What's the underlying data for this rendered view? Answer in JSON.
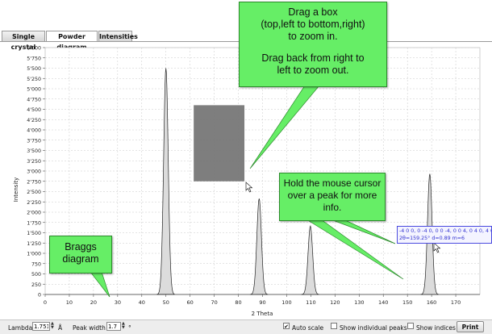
{
  "tabs": [
    {
      "label": "Single crystal",
      "active": false
    },
    {
      "label": "Powder diagram",
      "active": true
    },
    {
      "label": "Intensities",
      "active": false
    }
  ],
  "callouts": {
    "zoom_line1": "Drag a box",
    "zoom_line2": "(top,left to bottom,right)",
    "zoom_line3": "to zoom in.",
    "zoom_line4": "Drag back from right to",
    "zoom_line5": "left to zoom out.",
    "hover_line1": "Hold the mouse cursor",
    "hover_line2": "over a peak for more",
    "hover_line3": "info.",
    "braggs_line1": "Braggs",
    "braggs_line2": "diagram"
  },
  "tooltip": {
    "line1": "-4 0 0, 0 -4 0, 0 0 -4, 0 0 4, 0 4 0, 4 0 0",
    "line2": "2θ=159.25° d=0.89 m=6"
  },
  "chart_data": {
    "type": "line",
    "xlabel": "2 Theta",
    "ylabel": "Intensity",
    "xlim": [
      0,
      180
    ],
    "ylim": [
      0,
      6000
    ],
    "x_ticks": [
      0,
      10,
      20,
      30,
      40,
      50,
      60,
      70,
      80,
      90,
      100,
      110,
      120,
      130,
      140,
      150,
      160,
      170
    ],
    "y_ticks": [
      "0",
      "250",
      "500",
      "750",
      "1'000",
      "1'250",
      "1'500",
      "1'750",
      "2'000",
      "2'250",
      "2'500",
      "2'750",
      "3'000",
      "3'250",
      "3'500",
      "3'750",
      "4'000",
      "4'250",
      "4'500",
      "4'750",
      "5'000",
      "5'250",
      "5'500",
      "5'750",
      "6'000"
    ],
    "grid": true,
    "peaks": [
      {
        "two_theta": 50.0,
        "intensity": 5500
      },
      {
        "two_theta": 88.6,
        "intensity": 2330
      },
      {
        "two_theta": 109.8,
        "intensity": 1660
      },
      {
        "two_theta": 159.25,
        "intensity": 2930
      }
    ],
    "zoom_box": {
      "x_from": 61.5,
      "x_to": 82.5,
      "y_from": 2750,
      "y_to": 4600
    }
  },
  "bottom": {
    "lambda_label": "Lambda",
    "lambda_value": "1.751",
    "lambda_unit": "Å",
    "peak_width_label": "Peak width",
    "peak_width_value": "1.7",
    "peak_width_unit": "°",
    "auto_scale_label": "Auto scale",
    "auto_scale_checked": true,
    "show_individual_label": "Show individual peaks",
    "show_individual_checked": false,
    "show_indices_label": "Show indices",
    "show_indices_checked": false,
    "print_label": "Print"
  },
  "colors": {
    "peak_fill": "#dcdcdc",
    "peak_line": "#222222",
    "callout": "#66ee66",
    "zoom_box": "#777777"
  }
}
